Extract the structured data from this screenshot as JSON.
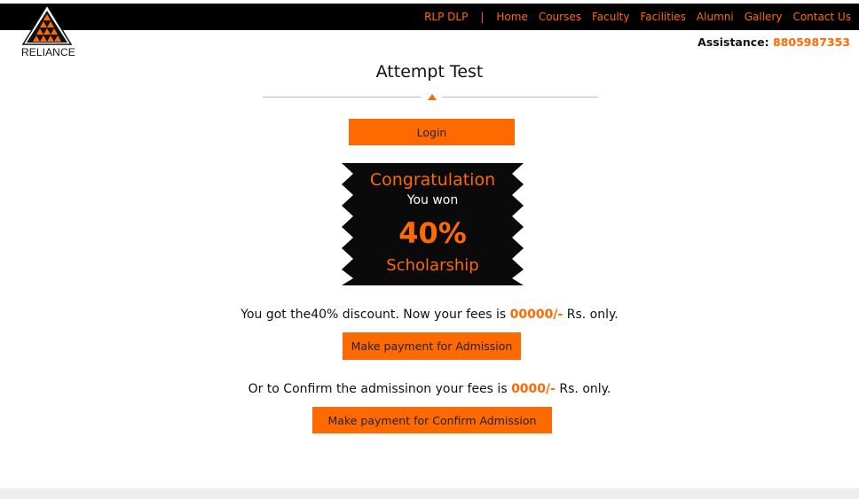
{
  "brand": {
    "logo_text": "RELIANCE"
  },
  "nav": {
    "items": [
      {
        "label": "RLP DLP"
      },
      {
        "label": "Home"
      },
      {
        "label": "Courses"
      },
      {
        "label": "Faculty"
      },
      {
        "label": "Facilities"
      },
      {
        "label": "Alumni"
      },
      {
        "label": "Gallery"
      },
      {
        "label": "Contact Us"
      }
    ],
    "separator": "|"
  },
  "assistance": {
    "label": "Assistance:",
    "phone": "8805987353"
  },
  "page": {
    "title": "Attempt Test",
    "login_label": "Login"
  },
  "badge": {
    "heading": "Congratulation",
    "subheading": "You won",
    "percent": "40%",
    "caption": "Scholarship"
  },
  "offer": {
    "line1_prefix": "You got the40% discount. Now your fees is",
    "line1_amount": "00000/-",
    "line1_suffix": "Rs. only.",
    "pay_label": "Make payment for Admission",
    "line2_prefix": "Or to Confirm the admissinon your fees is",
    "line2_amount": "0000/-",
    "line2_suffix": "Rs. only.",
    "confirm_label": "Make payment for Confirm Admission"
  },
  "colors": {
    "accent": "#ff6a00",
    "topbar": "#000000",
    "badge_bg": "#0a0a0a"
  }
}
